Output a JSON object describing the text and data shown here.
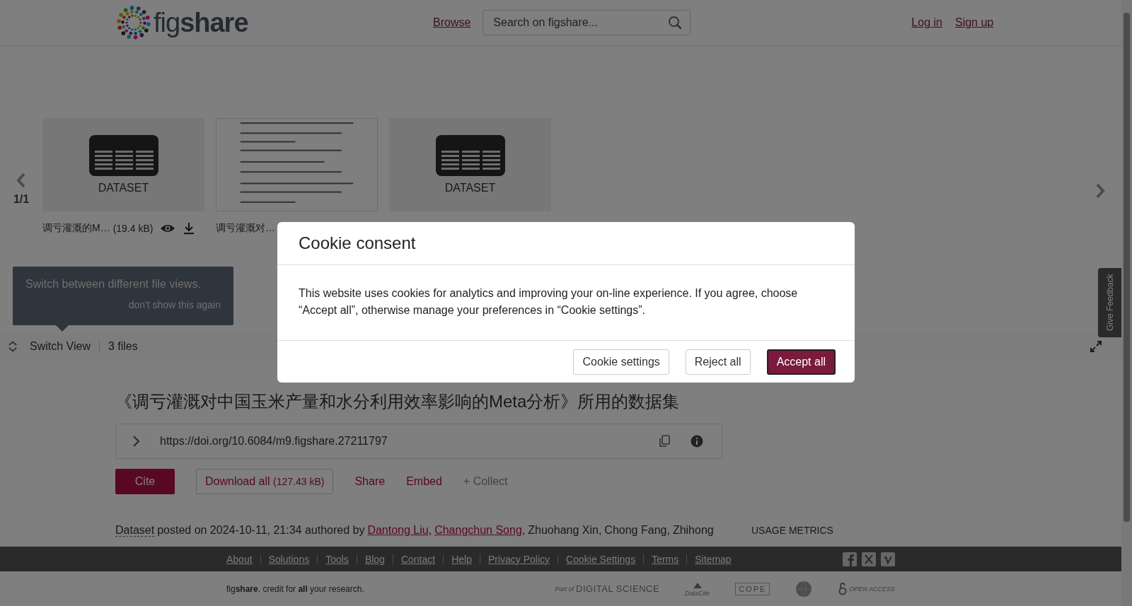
{
  "header": {
    "logo": "fig**share**",
    "nav_link": "Browse",
    "search": {
      "placeholder": "Search on figshare..."
    },
    "auth_links": [
      "Log in",
      "Sign up"
    ]
  },
  "carousel": {
    "pager": "1/1",
    "files": [
      {
        "kind": "dataset",
        "type_label": "DATASET",
        "name": "调亏灌溉的M…",
        "size": "(19.4 kB)"
      },
      {
        "kind": "document",
        "name": "调亏灌溉对…"
      },
      {
        "kind": "dataset",
        "type_label": "DATASET"
      }
    ]
  },
  "tooltip": {
    "text": "Switch between different file views.",
    "dismiss": "don't show this again"
  },
  "toolbar": {
    "switch_view": "Switch View",
    "file_count": "3 files"
  },
  "feedback_tab": "Give Feedback",
  "article": {
    "title": "《调亏灌溉对中国玉米产量和水分利用效率影响的Meta分析》所用的数据集",
    "doi": "https://doi.org/10.6084/m9.figshare.27211797",
    "actions": [
      {
        "kind": "primary",
        "label": "Cite"
      },
      {
        "kind": "outline",
        "label": "Download all",
        "extra": "(127.43 kB)"
      },
      {
        "kind": "link",
        "label": "Share"
      },
      {
        "kind": "link",
        "label": "Embed"
      },
      {
        "kind": "muted",
        "label": "+ Collect"
      }
    ],
    "item_type": "Dataset",
    "posted": "posted on 2024-10-11, 21:34 authored by",
    "authors": [
      {
        "name": "Dantong Liu",
        "linked": true,
        "after": ","
      },
      {
        "name": "Changchun Song",
        "linked": true,
        "after": ","
      },
      {
        "name": "Zhuohang Xin",
        "linked": false,
        "after": ","
      },
      {
        "name": "Chong Fang",
        "linked": false,
        "after": ","
      },
      {
        "name": "Zhihong",
        "linked": false
      }
    ],
    "usage_label": "USAGE METRICS"
  },
  "cookie_modal": {
    "title": "Cookie consent",
    "body": "This website uses cookies for analytics and improving your on-line experience. If you agree, choose “Accept all”, otherwise manage your preferences in “Cookie settings”.",
    "buttons": [
      {
        "label": "Cookie settings",
        "kind": "secondary"
      },
      {
        "label": "Reject all",
        "kind": "secondary"
      },
      {
        "label": "Accept all",
        "kind": "primary"
      }
    ]
  },
  "footer": {
    "links": [
      "About",
      "Solutions",
      "Tools",
      "Blog",
      "Contact",
      "Help",
      "Privacy Policy",
      "Cookie Settings",
      "Terms",
      "Sitemap"
    ],
    "tagline": "fig**share**. credit for **all** your research.",
    "partners": [
      {
        "kind": "digital_science",
        "prefix": "Part of",
        "name": "DIGITAL SCIENCE"
      },
      {
        "kind": "datacite",
        "name": "DataCite"
      },
      {
        "kind": "cope",
        "name": "COPE"
      },
      {
        "kind": "globe"
      },
      {
        "kind": "open_access",
        "name": "OPEN ACCESS"
      }
    ]
  }
}
